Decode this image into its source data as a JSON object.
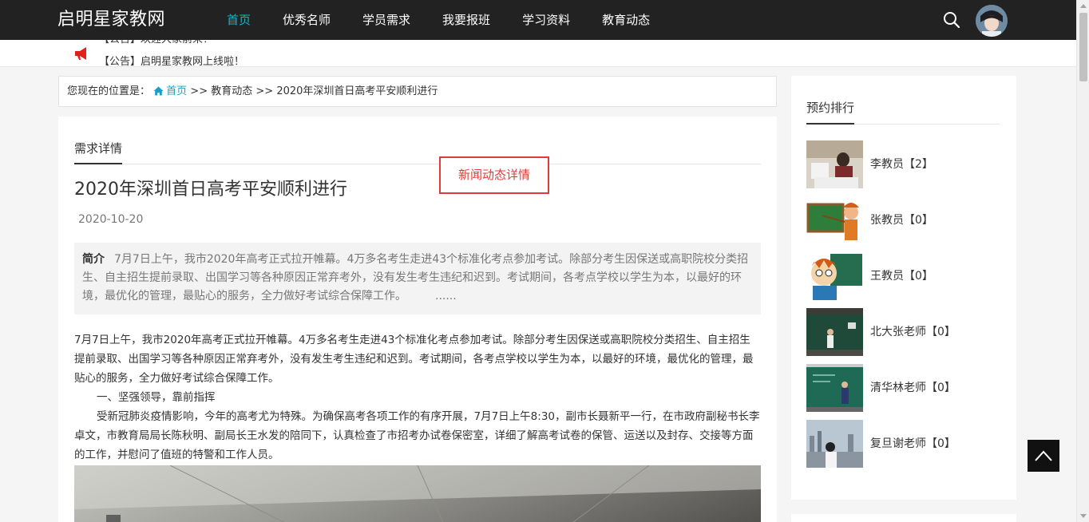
{
  "header": {
    "logo": "启明星家教网",
    "nav": [
      "首页",
      "优秀名师",
      "学员需求",
      "我要报班",
      "学习资料",
      "教育动态"
    ]
  },
  "notice": [
    "【公告】欢迎大家前来！",
    "【公告】启明星家教网上线啦！"
  ],
  "breadcrumb": {
    "prefix": "您现在的位置是：",
    "home": "首页",
    "sep1": " >> ",
    "section": "教育动态",
    "sep2": " >> ",
    "current": "2020年深圳首日高考平安顺利进行"
  },
  "article": {
    "tab": "需求详情",
    "annotation": "新闻动态详情",
    "title": "2020年深圳首日高考平安顺利进行",
    "date": "2020-10-20",
    "summary_label": "简介",
    "summary": "7月7日上午，我市2020年高考正式拉开帷幕。4万多名考生走进43个标准化考点参加考试。除部分考生因保送或高职院校分类招生、自主招生提前录取、出国学习等各种原因正常弃考外，没有发生考生违纪和迟到。考试期间，各考点学校以学生为本，以最好的环境，最优化的管理，最贴心的服务，全力做好考试综合保障工作。",
    "summary_more": "......",
    "p1": "7月7日上午，我市2020年高考正式拉开帷幕。4万多名考生走进43个标准化考点参加考试。除部分考生因保送或高职院校分类招生、自主招生提前录取、出国学习等各种原因正常弃考外，没有发生考生违纪和迟到。考试期间，各考点学校以学生为本，以最好的环境，最优化的管理，最贴心的服务，全力做好考试综合保障工作。",
    "p2": "一、坚强领导，靠前指挥",
    "p3": "受新冠肺炎疫情影响，今年的高考尤为特殊。为确保高考各项工作的有序开展，7月7日上午8:30，副市长聂新平一行，在市政府副秘书长李卓文，市教育局局长陈秋明、副局长王水发的陪同下，认真检查了市招考办试卷保密室，详细了解高考试卷的保管、运送以及封存、交接等方面的工作，并慰问了值班的特警和工作人员。"
  },
  "sidebar": {
    "title": "预约排行",
    "items": [
      {
        "name": "李教员【2】"
      },
      {
        "name": "张教员【0】"
      },
      {
        "name": "王教员【0】"
      },
      {
        "name": "北大张老师【0】"
      },
      {
        "name": "清华林老师【0】"
      },
      {
        "name": "复旦谢老师【0】"
      }
    ]
  },
  "colors": {
    "accent": "#19b3c8",
    "annotation": "#e03b3b",
    "topbar": "#222222"
  }
}
